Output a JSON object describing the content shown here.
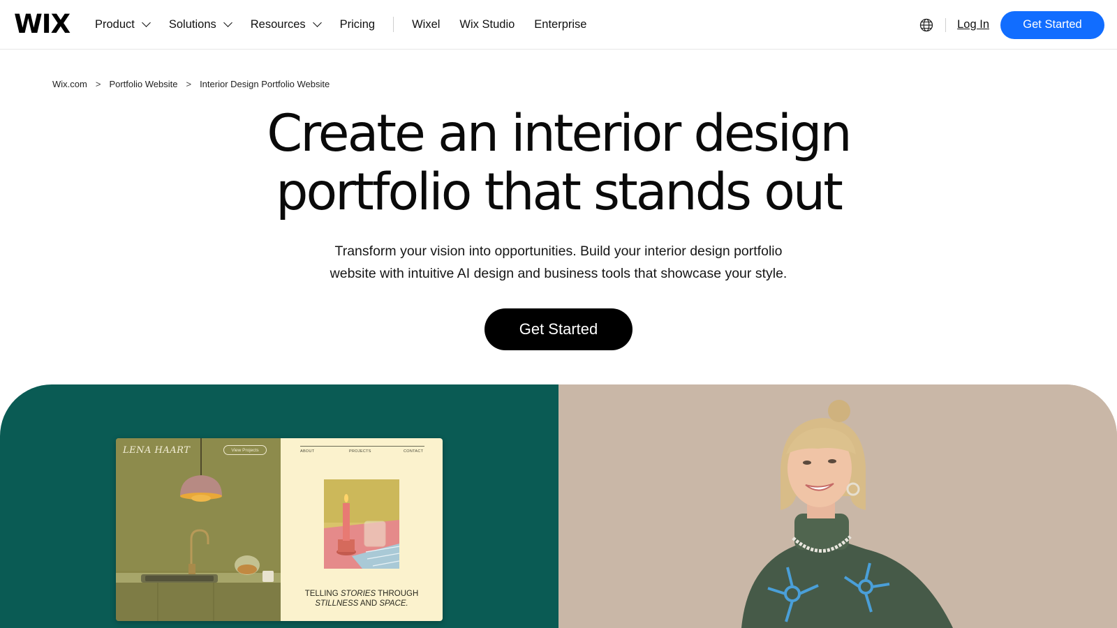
{
  "header": {
    "logo": "WIX",
    "nav": [
      {
        "label": "Product",
        "dropdown": true
      },
      {
        "label": "Solutions",
        "dropdown": true
      },
      {
        "label": "Resources",
        "dropdown": true
      },
      {
        "label": "Pricing",
        "dropdown": false
      }
    ],
    "nav_secondary": [
      "Wixel",
      "Wix Studio",
      "Enterprise"
    ],
    "login": "Log In",
    "cta": "Get Started"
  },
  "breadcrumb": [
    "Wix.com",
    "Portfolio Website",
    "Interior Design Portfolio Website"
  ],
  "hero": {
    "title_line1": "Create an interior design",
    "title_line2": "portfolio that stands out",
    "subtitle_line1": "Transform your vision into opportunities. Build your interior design portfolio",
    "subtitle_line2": "website with intuitive AI design and business tools that showcase your style.",
    "cta": "Get Started"
  },
  "mock_site": {
    "brand": "LENA HAART",
    "view_button": "View Projects",
    "menu": [
      "ABOUT",
      "PROJECTS",
      "CONTACT"
    ],
    "caption_a": "TELLING ",
    "caption_b": "STORIES",
    "caption_c": " THROUGH",
    "caption_d": "STILLNESS",
    "caption_e": " AND ",
    "caption_f": "SPACE."
  },
  "colors": {
    "brand_blue": "#116dff",
    "teal_panel": "#0a5b54",
    "beige_panel": "#c6b4a4",
    "cream": "#fbf2cd"
  }
}
